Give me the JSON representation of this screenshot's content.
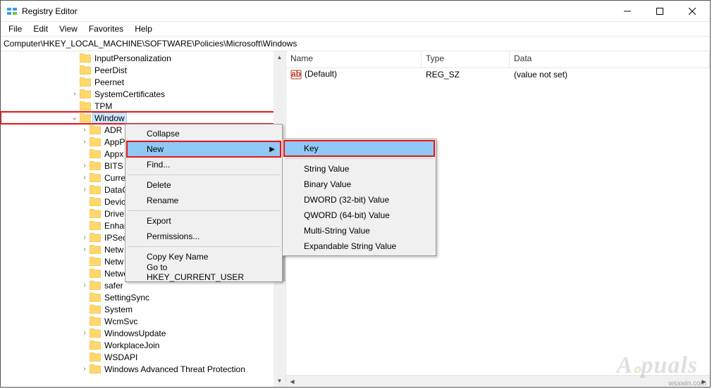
{
  "window": {
    "title": "Registry Editor"
  },
  "menu": {
    "file": "File",
    "edit": "Edit",
    "view": "View",
    "favorites": "Favorites",
    "help": "Help"
  },
  "address": {
    "path": "Computer\\HKEY_LOCAL_MACHINE\\SOFTWARE\\Policies\\Microsoft\\Windows"
  },
  "tree": {
    "items": [
      {
        "indent": 7,
        "exp": "none",
        "label": "InputPersonalization"
      },
      {
        "indent": 7,
        "exp": "none",
        "label": "PeerDist"
      },
      {
        "indent": 7,
        "exp": "none",
        "label": "Peernet"
      },
      {
        "indent": 7,
        "exp": "closed",
        "label": "SystemCertificates"
      },
      {
        "indent": 7,
        "exp": "none",
        "label": "TPM"
      },
      {
        "indent": 7,
        "exp": "open",
        "label": "Window",
        "selected": true,
        "highlighted": true
      },
      {
        "indent": 8,
        "exp": "closed",
        "label": "ADR"
      },
      {
        "indent": 8,
        "exp": "closed",
        "label": "AppP"
      },
      {
        "indent": 8,
        "exp": "none",
        "label": "Appx"
      },
      {
        "indent": 8,
        "exp": "closed",
        "label": "BITS"
      },
      {
        "indent": 8,
        "exp": "closed",
        "label": "Curre"
      },
      {
        "indent": 8,
        "exp": "closed",
        "label": "DataC"
      },
      {
        "indent": 8,
        "exp": "none",
        "label": "Devic"
      },
      {
        "indent": 8,
        "exp": "none",
        "label": "Drive"
      },
      {
        "indent": 8,
        "exp": "none",
        "label": "Enhar"
      },
      {
        "indent": 8,
        "exp": "closed",
        "label": "IPSec"
      },
      {
        "indent": 8,
        "exp": "closed",
        "label": "Netw"
      },
      {
        "indent": 8,
        "exp": "none",
        "label": "Netw"
      },
      {
        "indent": 8,
        "exp": "none",
        "label": "NetworkProvider"
      },
      {
        "indent": 8,
        "exp": "closed",
        "label": "safer"
      },
      {
        "indent": 8,
        "exp": "none",
        "label": "SettingSync"
      },
      {
        "indent": 8,
        "exp": "none",
        "label": "System"
      },
      {
        "indent": 8,
        "exp": "none",
        "label": "WcmSvc"
      },
      {
        "indent": 8,
        "exp": "closed",
        "label": "WindowsUpdate"
      },
      {
        "indent": 8,
        "exp": "none",
        "label": "WorkplaceJoin"
      },
      {
        "indent": 8,
        "exp": "none",
        "label": "WSDAPI"
      },
      {
        "indent": 8,
        "exp": "closed",
        "label": "Windows Advanced Threat Protection"
      }
    ]
  },
  "list": {
    "headers": {
      "name": "Name",
      "type": "Type",
      "data": "Data"
    },
    "rows": [
      {
        "name": "(Default)",
        "type": "REG_SZ",
        "data": "(value not set)"
      }
    ]
  },
  "context_menu": {
    "collapse": "Collapse",
    "new": "New",
    "find": "Find...",
    "delete": "Delete",
    "rename": "Rename",
    "export": "Export",
    "permissions": "Permissions...",
    "copy_key": "Copy Key Name",
    "goto_hkcu": "Go to HKEY_CURRENT_USER"
  },
  "submenu": {
    "key": "Key",
    "string": "String Value",
    "binary": "Binary Value",
    "dword": "DWORD (32-bit) Value",
    "qword": "QWORD (64-bit) Value",
    "multi": "Multi-String Value",
    "expand": "Expandable String Value"
  },
  "watermark": {
    "site": "wsxwin.com",
    "logo": "A  puals"
  }
}
